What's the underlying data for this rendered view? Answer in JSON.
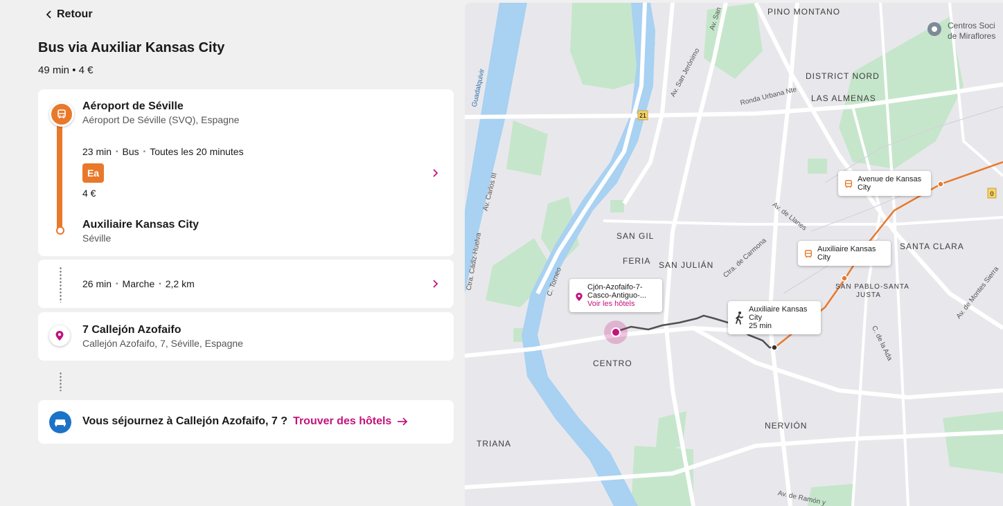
{
  "nav": {
    "back_label": "Retour"
  },
  "route": {
    "title": "Bus via Auxiliar Kansas City",
    "summary": "49 min • 4 €"
  },
  "segments": {
    "bus": {
      "origin_name": "Aéroport de Séville",
      "origin_sub": "Aéroport De Séville (SVQ), Espagne",
      "duration": "23 min",
      "mode": "Bus",
      "frequency": "Toutes les 20 minutes",
      "line": "Ea",
      "price": "4 €",
      "dest_name": "Auxiliaire Kansas City",
      "dest_sub": "Séville"
    },
    "walk": {
      "duration": "26 min",
      "mode": "Marche",
      "distance": "2,2 km"
    },
    "destination": {
      "name": "7 Callejón Azofaifo",
      "sub": "Callejón Azofaifo, 7, Séville, Espagne"
    }
  },
  "hotels": {
    "prompt": "Vous séjournez à Callejón Azofaifo, 7 ?",
    "link": "Trouver des hôtels"
  },
  "map": {
    "areas": [
      "PINO MONTANO",
      "DISTRICT NORD",
      "LAS ALMENAS",
      "SAN GIL",
      "FERIA",
      "SAN JULIÁN",
      "SANTA CLARA",
      "CENTRO",
      "NERVIÓN",
      "TRIANA",
      "SAN PABLO-SANTA",
      "JUSTA"
    ],
    "streets": [
      "Av. San Jerónimo",
      "Ronda Urbana Nte",
      "Av. de Llanes",
      "Ctra. de Carmona",
      "C. Torneo",
      "Av. Carlos III",
      "Ctra. Cádiz-Huelva",
      "Guadalquivir",
      "Av. de Montes Sierra",
      "C. de la Ada",
      "Av. de Ramón y",
      "Av. San"
    ],
    "road_numbers": [
      "21",
      "0"
    ],
    "poi": {
      "line1": "Centros Soci",
      "line2": "de Miraflores"
    },
    "callouts": {
      "dest": {
        "line1": "Cjón-Azofaifo-7-",
        "line2": "Casco-Antiguo-...",
        "link": "Voir les hôtels"
      },
      "walk": {
        "line1": "Auxiliaire Kansas",
        "line2": "City",
        "time": "25 min"
      },
      "stop1": {
        "line1": "Avenue de Kansas",
        "line2": "City"
      },
      "stop2": {
        "line1": "Auxiliaire Kansas",
        "line2": "City"
      }
    }
  },
  "colors": {
    "bus": "#e8792b",
    "accent": "#c3137d",
    "hotel": "#1a73c9",
    "river": "#a8d1f2",
    "park": "#c6e6cb"
  }
}
